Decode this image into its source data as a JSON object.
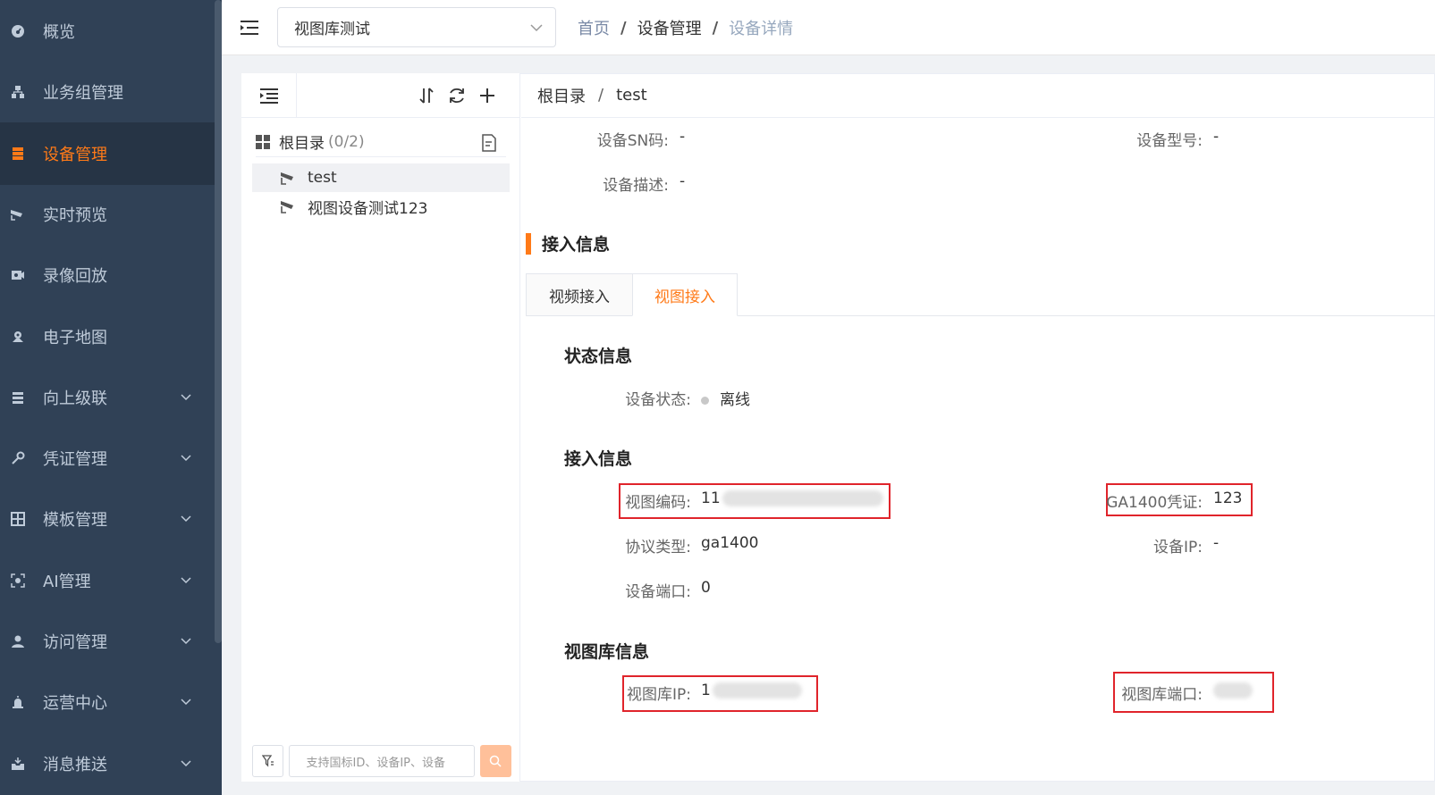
{
  "sidebar": {
    "items": [
      {
        "label": "概览",
        "icon": "dashboard-icon",
        "active": false,
        "has_submenu": false
      },
      {
        "label": "业务组管理",
        "icon": "org-tree-icon",
        "active": false,
        "has_submenu": false
      },
      {
        "label": "设备管理",
        "icon": "server-list-icon",
        "active": true,
        "has_submenu": false
      },
      {
        "label": "实时预览",
        "icon": "camera-icon",
        "active": false,
        "has_submenu": false
      },
      {
        "label": "录像回放",
        "icon": "video-playback-icon",
        "active": false,
        "has_submenu": false
      },
      {
        "label": "电子地图",
        "icon": "map-pin-icon",
        "active": false,
        "has_submenu": false
      },
      {
        "label": "向上级联",
        "icon": "cascade-icon",
        "active": false,
        "has_submenu": true
      },
      {
        "label": "凭证管理",
        "icon": "key-icon",
        "active": false,
        "has_submenu": true
      },
      {
        "label": "模板管理",
        "icon": "template-grid-icon",
        "active": false,
        "has_submenu": true
      },
      {
        "label": "AI管理",
        "icon": "ai-scan-icon",
        "active": false,
        "has_submenu": true
      },
      {
        "label": "访问管理",
        "icon": "user-icon",
        "active": false,
        "has_submenu": true
      },
      {
        "label": "运营中心",
        "icon": "alarm-light-icon",
        "active": false,
        "has_submenu": true
      },
      {
        "label": "消息推送",
        "icon": "inbox-icon",
        "active": false,
        "has_submenu": true
      }
    ]
  },
  "header": {
    "project_select": "视图库测试",
    "breadcrumb": [
      "首页",
      "设备管理",
      "设备详情"
    ]
  },
  "tree": {
    "root_label": "根目录",
    "root_count": "(0/2)",
    "items": [
      "test",
      "视图设备测试123"
    ],
    "selected_index": 0,
    "search_placeholder": "支持国标ID、设备IP、设备"
  },
  "detail": {
    "breadcrumb": [
      "根目录",
      "test"
    ],
    "basic": {
      "sn_label": "设备SN码:",
      "sn_value": "-",
      "model_label": "设备型号:",
      "model_value": "-",
      "desc_label": "设备描述:",
      "desc_value": "-"
    },
    "access_section_title": "接入信息",
    "tabs": [
      "视频接入",
      "视图接入"
    ],
    "active_tab": 1,
    "status_title": "状态信息",
    "status_label": "设备状态:",
    "status_value": "离线",
    "access_title": "接入信息",
    "view_code_label": "视图编码:",
    "view_code_value": "11",
    "ga1400_label": "GA1400凭证:",
    "ga1400_value": "123",
    "protocol_label": "协议类型:",
    "protocol_value": "ga1400",
    "device_ip_label": "设备IP:",
    "device_ip_value": "-",
    "device_port_label": "设备端口:",
    "device_port_value": "0",
    "library_title": "视图库信息",
    "library_ip_label": "视图库IP:",
    "library_ip_value": "1",
    "library_port_label": "视图库端口:"
  },
  "colors": {
    "sidebar_bg": "#304156",
    "accent": "#ff7a18",
    "highlight_box": "#e0242b"
  }
}
